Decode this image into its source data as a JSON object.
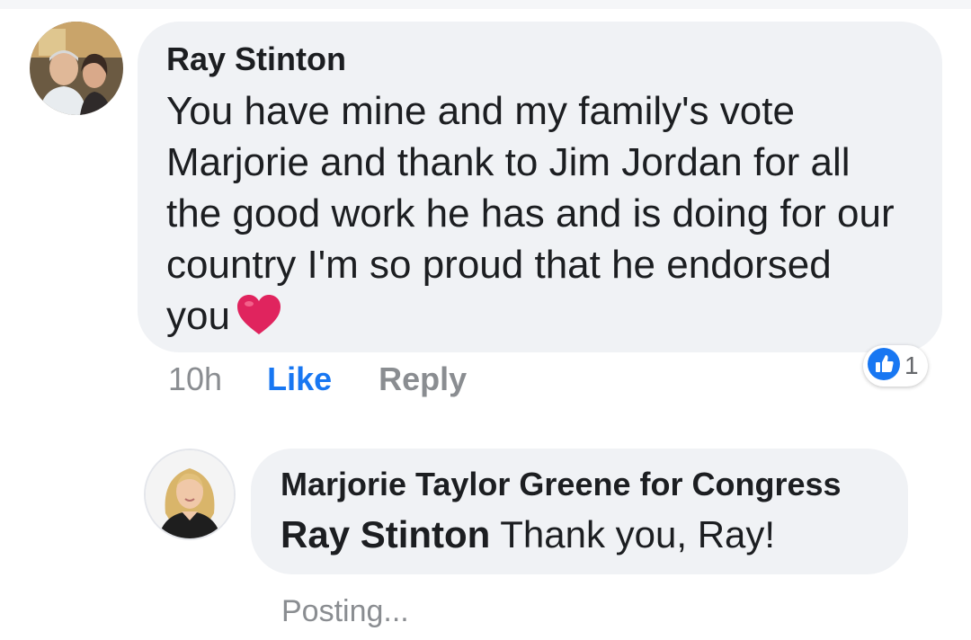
{
  "comment": {
    "author": "Ray Stinton",
    "text": "You have mine and my family's vote Marjorie and thank to Jim Jordan for all the good work he has and is doing for our country I'm so proud that he endorsed you",
    "emoji": "red-heart",
    "time": "10h",
    "like_label": "Like",
    "reply_label": "Reply",
    "reaction_count": "1",
    "reaction_color": "#1877f2"
  },
  "reply": {
    "author": "Marjorie Taylor Greene for Congress",
    "tag": "Ray Stinton",
    "text": " Thank you, Ray!",
    "status": "Posting..."
  },
  "colors": {
    "bubble": "#f0f2f5",
    "link": "#1877f2",
    "muted": "#8a8d91",
    "heart": "#e0245e"
  }
}
